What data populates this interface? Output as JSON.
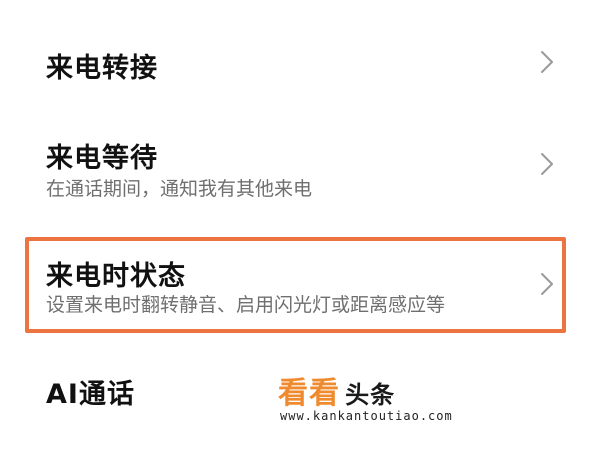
{
  "settings": {
    "items": [
      {
        "title": "来电转接",
        "subtitle": ""
      },
      {
        "title": "来电等待",
        "subtitle": "在通话期间，通知我有其他来电"
      },
      {
        "title": "来电时状态",
        "subtitle": "设置来电时翻转静音、启用闪光灯或距离感应等"
      },
      {
        "title": "AI通话",
        "subtitle": ""
      }
    ]
  },
  "icons": {
    "row_arrow": "chevron-right-icon"
  },
  "colors": {
    "highlight": "#ec7440",
    "watermark_accent": "#f08a2e"
  },
  "watermark": {
    "logo_main": "看看",
    "logo_sub": "头条",
    "url": "www.kankantoutiao.com"
  }
}
